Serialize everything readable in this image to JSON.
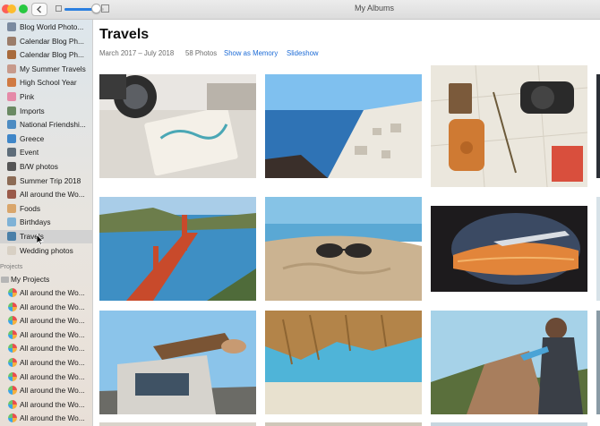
{
  "window": {
    "title": "My Albums"
  },
  "sidebar": {
    "albums": [
      {
        "label": "Blog World Photo...",
        "icon_color": "#7a8aa0"
      },
      {
        "label": "Calendar Blog Ph...",
        "icon_color": "#9b7d6a"
      },
      {
        "label": "Calendar Blog Ph...",
        "icon_color": "#a86a3b"
      },
      {
        "label": "My Summer Travels",
        "icon_color": "#c79a8b"
      },
      {
        "label": "High School Year",
        "icon_color": "#d07a43"
      },
      {
        "label": "Pink",
        "icon_color": "#e58aa8"
      },
      {
        "label": "Imports",
        "icon_color": "#6a8a63"
      },
      {
        "label": "National Friendshi...",
        "icon_color": "#4d8cc2"
      },
      {
        "label": "Greece",
        "icon_color": "#3f86c8"
      },
      {
        "label": "Event",
        "icon_color": "#5e6d7a"
      },
      {
        "label": "B/W photos",
        "icon_color": "#555555"
      },
      {
        "label": "Summer Trip 2018",
        "icon_color": "#8c6b55"
      },
      {
        "label": "All around the Wo...",
        "icon_color": "#9a5a4a"
      },
      {
        "label": "Foods",
        "icon_color": "#d9a66b"
      },
      {
        "label": "Birthdays",
        "icon_color": "#7fb2d6"
      },
      {
        "label": "Travels",
        "icon_color": "#4a7fa8",
        "selected": true
      },
      {
        "label": "Wedding photos",
        "icon_color": "#d8d0c4"
      }
    ],
    "projects_section": "Projects",
    "my_projects": "My Projects",
    "projects": [
      "All around the Wo...",
      "All around the Wo...",
      "All around the Wo...",
      "All around the Wo...",
      "All around the Wo...",
      "All around the Wo...",
      "All around the Wo...",
      "All around the Wo...",
      "All around the Wo...",
      "All around the Wo..."
    ]
  },
  "album": {
    "title": "Travels",
    "date_range": "March 2017 – July 2018",
    "photo_count": "58 Photos",
    "show_as_memory": "Show as Memory",
    "slideshow": "Slideshow"
  },
  "photos": [
    {
      "name": "photo-camera-map",
      "colors": [
        "#e9e6e2",
        "#cfc9c0",
        "#2d2d2d"
      ]
    },
    {
      "name": "photo-santorini",
      "colors": [
        "#6fb3e8",
        "#2b6cae",
        "#f2efe9"
      ]
    },
    {
      "name": "photo-map-backpack",
      "colors": [
        "#e8e4da",
        "#cf7a33",
        "#2a2a2a"
      ]
    },
    {
      "name": "photo-golden-gate",
      "colors": [
        "#3e8fc4",
        "#c84a2b",
        "#6c7d4b"
      ]
    },
    {
      "name": "photo-sunglasses-sand",
      "colors": [
        "#cbb391",
        "#76b8de",
        "#2d2a28"
      ]
    },
    {
      "name": "photo-airplane-window",
      "colors": [
        "#1d1b1d",
        "#e2853a",
        "#4b5a73"
      ]
    },
    {
      "name": "photo-van-feet",
      "colors": [
        "#8bc4ea",
        "#d6d3cd",
        "#7a5434"
      ]
    },
    {
      "name": "photo-straw-umbrella",
      "colors": [
        "#4fb4d8",
        "#b38449",
        "#e8e1cf"
      ]
    },
    {
      "name": "photo-hiker-rock",
      "colors": [
        "#a6d2e8",
        "#a87e5d",
        "#5a6f3c"
      ]
    }
  ]
}
